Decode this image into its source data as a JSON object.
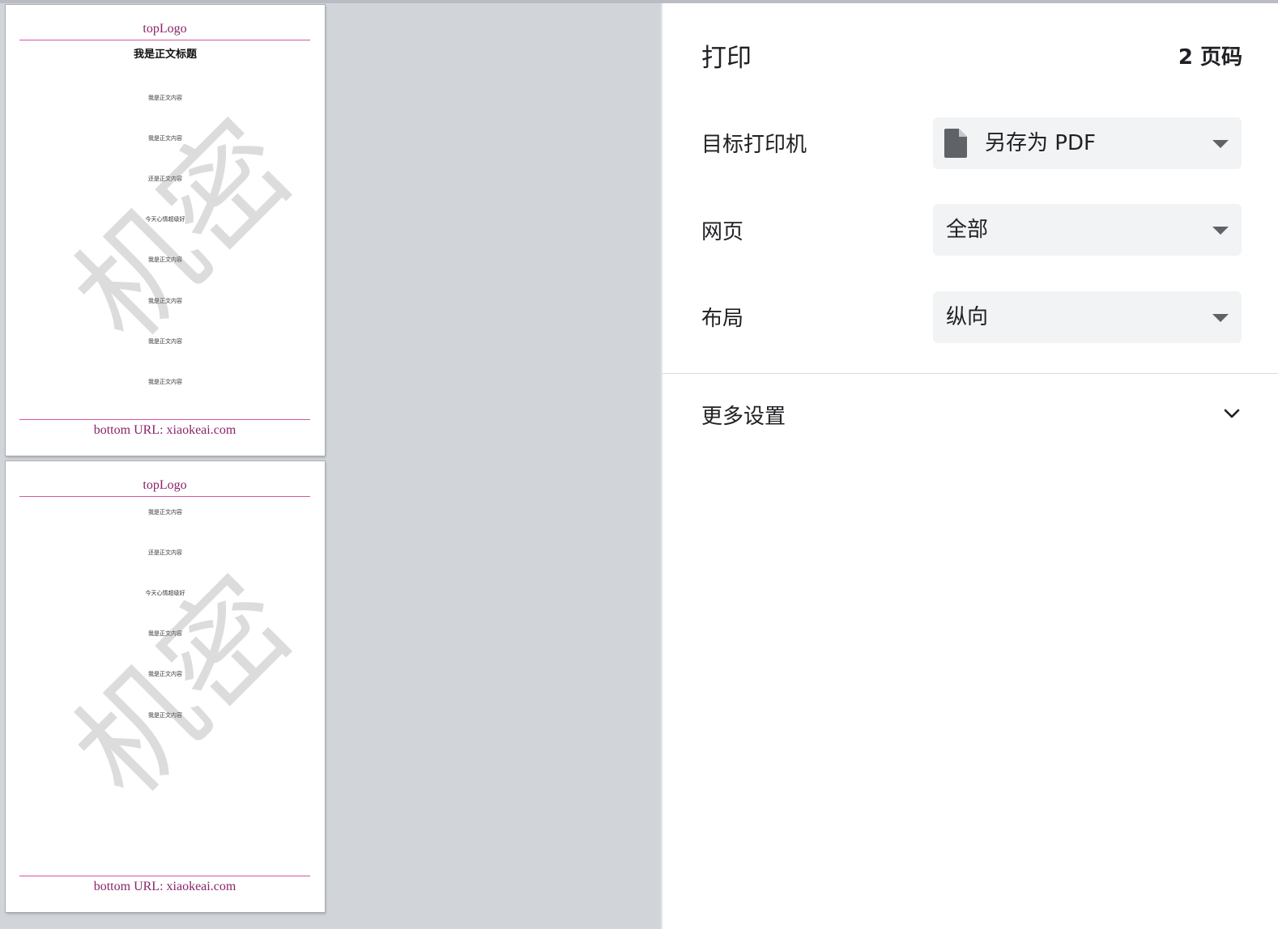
{
  "preview": {
    "pages": [
      {
        "header": "topLogo",
        "title": "我是正文标题",
        "lines": [
          "我是正文内容",
          "我是正文内容",
          "还是正文内容",
          "今天心情超级好",
          "我是正文内容",
          "我是正文内容",
          "我是正文内容",
          "我是正文内容"
        ],
        "watermark": "机密",
        "footer": "bottom URL: xiaokeai.com"
      },
      {
        "header": "topLogo",
        "lines": [
          "我是正文内容",
          "还是正文内容",
          "今天心情超级好",
          "我是正文内容",
          "我是正文内容",
          "我是正文内容"
        ],
        "watermark": "机密",
        "footer": "bottom URL: xiaokeai.com"
      }
    ]
  },
  "settings": {
    "title": "打印",
    "page_count": "2 页码",
    "destination": {
      "label": "目标打印机",
      "value": "另存为 PDF",
      "icon": "file-icon"
    },
    "pages": {
      "label": "网页",
      "value": "全部"
    },
    "layout": {
      "label": "布局",
      "value": "纵向"
    },
    "more_settings": {
      "label": "更多设置",
      "icon": "chevron-down-icon"
    }
  },
  "colors": {
    "preview_background": "#d1d4d9",
    "header_footer_rule": "#d9559a",
    "header_footer_text": "#8a2468",
    "select_background": "#f1f3f4"
  }
}
